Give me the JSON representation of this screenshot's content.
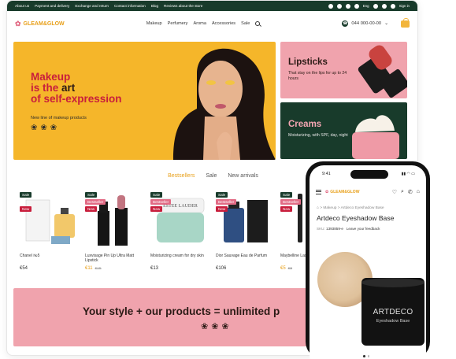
{
  "topbar": {
    "links": [
      "About us",
      "Payment and delivery",
      "Exchange and return",
      "Contact information",
      "Blog",
      "Reviews about the store"
    ],
    "lang": "Eng",
    "signin": "Sign in"
  },
  "header": {
    "logo": "GLEAM&GLOW",
    "nav": [
      "Makeup",
      "Perfumery",
      "Aroma",
      "Accessories",
      "Sale"
    ],
    "phone": "044 000-00-00"
  },
  "hero": {
    "line1": "Makeup",
    "line2a": "is the ",
    "line2b": "art",
    "line3a": "of ",
    "line3b": "self-expression",
    "sub": "New line of makeup products",
    "flowers": "❀❀❀"
  },
  "promos": [
    {
      "title": "Lipsticks",
      "sub": "That stay on the lips for up to 24 hours"
    },
    {
      "title": "Creams",
      "sub": "Moisturizing, with SPF, day, night"
    }
  ],
  "tabs": [
    "Bestsellers",
    "Sale",
    "New arrivals"
  ],
  "products": [
    {
      "name": "Chanel №5",
      "price": "€54",
      "old": "",
      "badges": [
        "Sale",
        "New"
      ]
    },
    {
      "name": "Luxvisage Pin Up Ultra Matt Lipstick",
      "price": "€11",
      "old": "€15",
      "badges": [
        "Sale",
        "Bestseller",
        "New"
      ]
    },
    {
      "name": "Moisturizing cream for dry skin",
      "price": "€13",
      "old": "",
      "badges": [
        "Sale",
        "Bestseller",
        "New"
      ]
    },
    {
      "name": "Dior Sauvage Eau de Parfum",
      "price": "€106",
      "old": "",
      "badges": [
        "Sale",
        "Bestseller",
        "New"
      ]
    },
    {
      "name": "Maybelline Lash Intense Black",
      "price": "€5",
      "old": "€9",
      "badges": [
        "Sale",
        "Bestseller",
        "New"
      ]
    }
  ],
  "banner": {
    "text": "Your style + our products = unlimited p",
    "flowers": "❀❀❀"
  },
  "mobile": {
    "time": "9:41",
    "logo": "GLEAM&GLOW",
    "crumbs": "⌂  >  Makeup  >  Artdeco Eyeshadow Base",
    "title": "Artdeco Eyeshadow Base",
    "sku_label": "SKU:",
    "sku": "1393859-e",
    "feedback": "Leave your feedback",
    "brand": "ARTDECO",
    "product_label": "Eyeshadow Base"
  },
  "colors": {
    "accent": "#e8a01a",
    "dark_green": "#183b2b",
    "pink": "#f0a3ad",
    "hero_yellow": "#f5b62a",
    "red": "#c81e3c"
  }
}
